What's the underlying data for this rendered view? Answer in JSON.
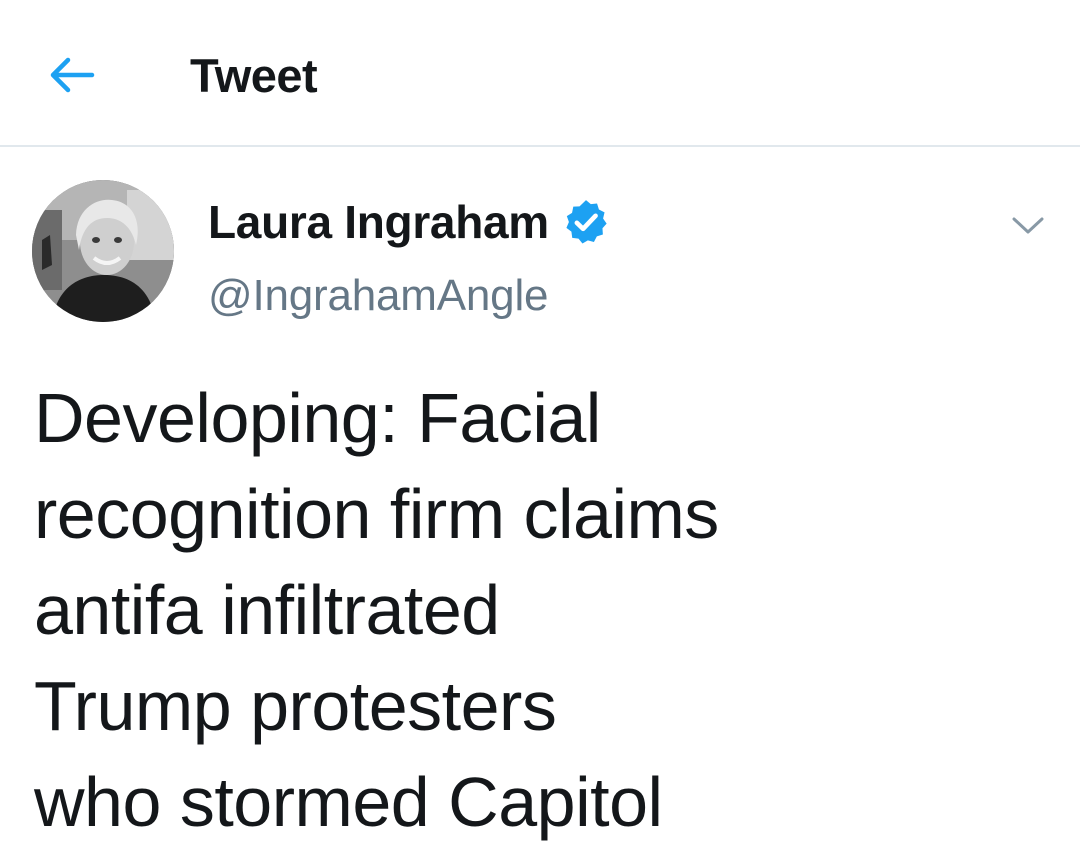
{
  "header": {
    "title": "Tweet",
    "back_icon": "arrow-left-icon",
    "accent_color": "#1da1f2"
  },
  "author": {
    "display_name": "Laura Ingraham",
    "handle": "@IngrahamAngle",
    "verified": true,
    "verified_icon": "verified-badge-icon",
    "menu_icon": "chevron-down-icon"
  },
  "tweet": {
    "lines": [
      "Developing: Facial",
      "recognition firm claims",
      "antifa infiltrated",
      "Trump protesters",
      "who stormed Capitol"
    ]
  }
}
